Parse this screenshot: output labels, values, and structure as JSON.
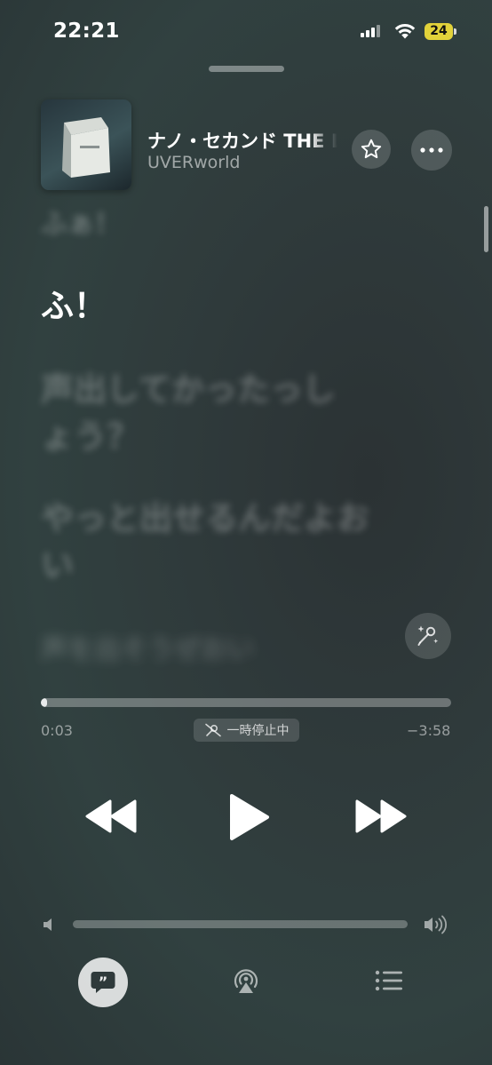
{
  "status_bar": {
    "time": "22:21",
    "battery": "24"
  },
  "now_playing": {
    "title": "ナノ・セカンド THE LIVE",
    "artist": "UVERworld"
  },
  "lyrics": {
    "prev": "ふぁ！",
    "current": "ふ！",
    "next1": "声出してかったっしょう？",
    "next2": "やっと出せるんだよおい",
    "next3": "声を出そうぜおい"
  },
  "playback": {
    "elapsed": "0:03",
    "remaining": "−3:58",
    "status_badge": "一時停止中",
    "progress_fraction": 0.015,
    "volume_fraction": 0.0
  },
  "colors": {
    "battery": "#e2d23a",
    "background": "#2f3a3b"
  },
  "icons": [
    "signal-icon",
    "wifi-icon",
    "battery-icon",
    "star-icon",
    "more-icon",
    "sing-icon",
    "mic-off-icon",
    "rewind-icon",
    "play-icon",
    "fast-forward-icon",
    "volume-low-icon",
    "volume-high-icon",
    "lyrics-icon",
    "airplay-icon",
    "queue-icon"
  ]
}
